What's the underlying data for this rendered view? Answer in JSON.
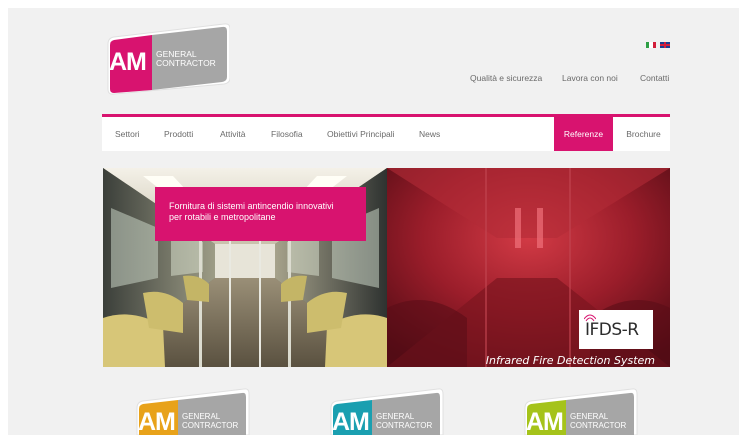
{
  "brand": {
    "am": "AM",
    "general": "GENERAL",
    "contractor": "CONTRACTOR",
    "color_magenta": "#d8136f",
    "color_gray": "#a6a6a6"
  },
  "languages": [
    "it",
    "en"
  ],
  "top_links": [
    {
      "label": "Qualità e sicurezza"
    },
    {
      "label": "Lavora con noi"
    },
    {
      "label": "Contatti"
    }
  ],
  "nav": {
    "items": [
      {
        "label": "Settori"
      },
      {
        "label": "Prodotti"
      },
      {
        "label": "Attività"
      },
      {
        "label": "Filosofia"
      },
      {
        "label": "Obiettivi Principali"
      },
      {
        "label": "News"
      }
    ],
    "referenze": "Referenze",
    "brochure": "Brochure"
  },
  "banner": {
    "callout_line1": "Fornitura di sistemi antincendio innovativi",
    "callout_line2": "per rotabili e metropolitane",
    "badge": "IFDS-R",
    "tagline": "Infrared Fire Detection System"
  },
  "bottom_logos": [
    {
      "color": "#e8a21a"
    },
    {
      "color": "#1a9fb0"
    },
    {
      "color": "#a5c31a"
    }
  ]
}
